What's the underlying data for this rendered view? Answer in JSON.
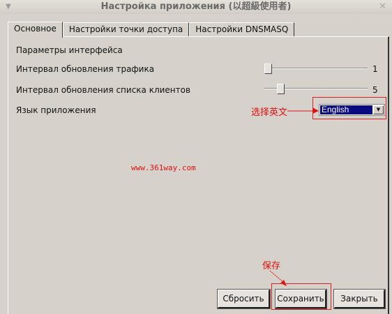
{
  "window": {
    "title": "Настройка приложения (以超級使用者)",
    "menu_icon": "chevron-down-icon",
    "close_icon": "close-icon"
  },
  "tabs": [
    {
      "label": "Основное",
      "active": true
    },
    {
      "label": "Настройки точки доступа"
    },
    {
      "label": "Настройки DNSMASQ"
    }
  ],
  "general": {
    "section_title": "Параметры интерфейса",
    "traffic_interval": {
      "label": "Интервал обновления трафика",
      "value": "1"
    },
    "clients_interval": {
      "label": "Интервал обновления списка клиентов",
      "value": "5"
    },
    "language": {
      "label": "Язык приложения",
      "selected": "English"
    }
  },
  "annotations": {
    "select_english": "选择英文",
    "save": "保存",
    "watermark": "www.361way.com",
    "color": "#e01010"
  },
  "buttons": {
    "reset": "Сбросить",
    "save": "Сохранить",
    "close": "Закрыть"
  }
}
